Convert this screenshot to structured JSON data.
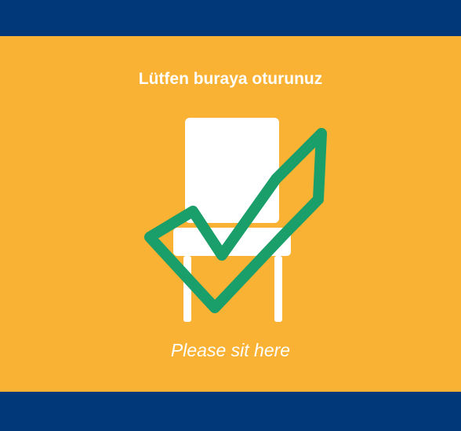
{
  "sign": {
    "title": "Lütfen buraya oturunuz",
    "subtitle": "Please sit here",
    "icons": [
      "chair-icon",
      "checkmark-icon"
    ]
  },
  "colors": {
    "background": "#F9B233",
    "bands": "#00387A",
    "text": "#FFFFFF",
    "chair": "#FFFFFF",
    "checkmark": "#1A9E6A"
  }
}
